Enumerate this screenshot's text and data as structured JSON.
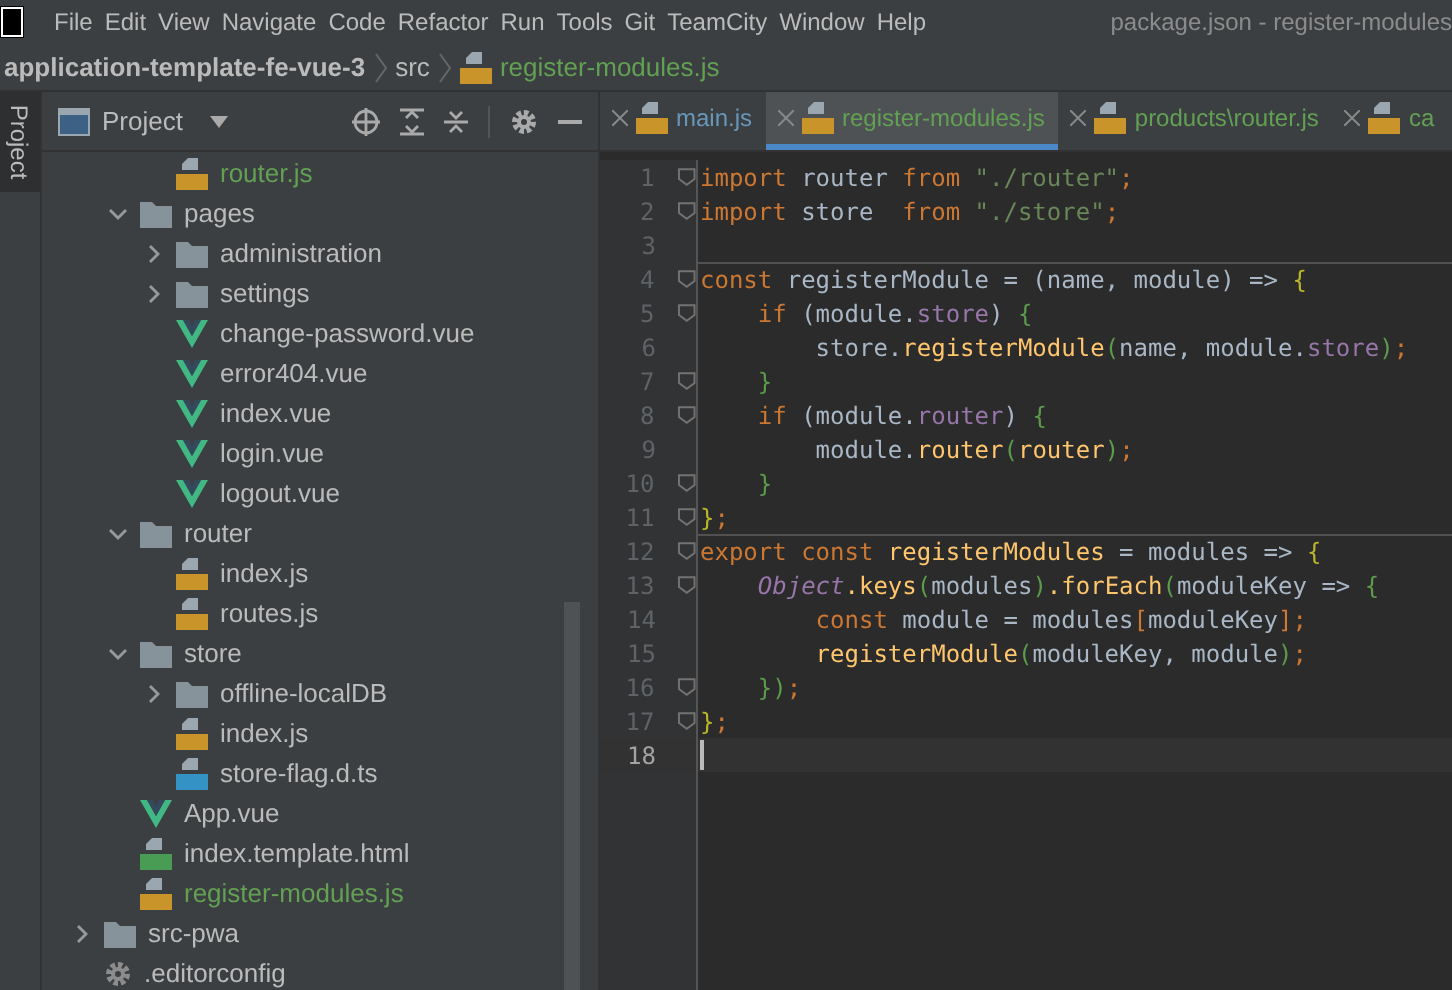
{
  "menu": {
    "items": [
      "File",
      "Edit",
      "View",
      "Navigate",
      "Code",
      "Refactor",
      "Run",
      "Tools",
      "Git",
      "TeamCity",
      "Window",
      "Help"
    ],
    "title": "package.json - register-modules"
  },
  "breadcrumb": [
    {
      "label": "application-template-fe-vue-3",
      "kind": "project"
    },
    {
      "label": "src",
      "kind": "folder"
    },
    {
      "label": "register-modules.js",
      "kind": "js"
    }
  ],
  "side_stripe": {
    "label": "Project"
  },
  "project_panel": {
    "title": "Project"
  },
  "tree": [
    {
      "children": [
        {
          "children": [
            {
              "name": "router.js",
              "kind": "js",
              "color": "#62a053"
            }
          ]
        },
        {
          "name": "pages",
          "kind": "folder",
          "expanded": true,
          "children": [
            {
              "name": "administration",
              "kind": "folder",
              "expanded": false
            },
            {
              "name": "settings",
              "kind": "folder",
              "expanded": false
            },
            {
              "name": "change-password.vue",
              "kind": "vue"
            },
            {
              "name": "error404.vue",
              "kind": "vue"
            },
            {
              "name": "index.vue",
              "kind": "vue"
            },
            {
              "name": "login.vue",
              "kind": "vue"
            },
            {
              "name": "logout.vue",
              "kind": "vue"
            }
          ]
        },
        {
          "name": "router",
          "kind": "folder",
          "expanded": true,
          "children": [
            {
              "name": "index.js",
              "kind": "js"
            },
            {
              "name": "routes.js",
              "kind": "js"
            }
          ]
        },
        {
          "name": "store",
          "kind": "folder",
          "expanded": true,
          "children": [
            {
              "name": "offline-localDB",
              "kind": "folder",
              "expanded": false
            },
            {
              "name": "index.js",
              "kind": "js"
            },
            {
              "name": "store-flag.d.ts",
              "kind": "ts"
            }
          ]
        },
        {
          "name": "App.vue",
          "kind": "vue"
        },
        {
          "name": "index.template.html",
          "kind": "html"
        },
        {
          "name": "register-modules.js",
          "kind": "js",
          "color": "#62a053"
        }
      ]
    },
    {
      "name": "src-pwa",
      "kind": "folder",
      "expanded": false
    },
    {
      "name": ".editorconfig",
      "kind": "config"
    }
  ],
  "tabs": [
    {
      "label": "main.js",
      "color": "#6897bb",
      "selected": false
    },
    {
      "label": "register-modules.js",
      "color": "#62a053",
      "selected": true
    },
    {
      "label": "products\\router.js",
      "color": "#62a053",
      "selected": false
    },
    {
      "label": "ca",
      "color": "#62a053",
      "selected": false
    }
  ],
  "editor": {
    "lines": [
      {
        "number": "1",
        "fold": true,
        "separator_above": false,
        "current": false,
        "tokens": [
          {
            "text": "import",
            "kind": "kw"
          },
          {
            "text": " router ",
            "kind": "id"
          },
          {
            "text": "from",
            "kind": "kw"
          },
          {
            "text": " \"./router\"",
            "kind": "str"
          },
          {
            "text": ";",
            "kind": "kw"
          }
        ]
      },
      {
        "number": "2",
        "fold": true,
        "separator_above": false,
        "current": false,
        "tokens": [
          {
            "text": "import",
            "kind": "kw"
          },
          {
            "text": " store  ",
            "kind": "id"
          },
          {
            "text": "from",
            "kind": "kw"
          },
          {
            "text": " \"./store\"",
            "kind": "str"
          },
          {
            "text": ";",
            "kind": "kw"
          }
        ]
      },
      {
        "number": "3",
        "fold": false,
        "separator_above": false,
        "current": false
      },
      {
        "number": "4",
        "fold": true,
        "separator_above": true,
        "current": false,
        "tokens": [
          {
            "text": "const",
            "kind": "kw"
          },
          {
            "text": " registerModule = (name, module) => ",
            "kind": "id"
          },
          {
            "text": "{",
            "kind": "br2"
          }
        ]
      },
      {
        "number": "5",
        "fold": true,
        "separator_above": false,
        "current": false,
        "tokens": [
          {
            "text": "    if",
            "kind": "kw"
          },
          {
            "text": " (module.",
            "kind": "id"
          },
          {
            "text": "store",
            "kind": "prop"
          },
          {
            "text": ") ",
            "kind": "id"
          },
          {
            "text": "{",
            "kind": "br"
          }
        ]
      },
      {
        "number": "6",
        "fold": false,
        "separator_above": false,
        "current": false,
        "tokens": [
          {
            "text": "        store.",
            "kind": "id"
          },
          {
            "text": "registerModule",
            "kind": "fn"
          },
          {
            "text": "(",
            "kind": "br"
          },
          {
            "text": "name, module.",
            "kind": "id"
          },
          {
            "text": "store",
            "kind": "prop"
          },
          {
            "text": ")",
            "kind": "br"
          },
          {
            "text": ";",
            "kind": "kw"
          }
        ]
      },
      {
        "number": "7",
        "fold": true,
        "separator_above": false,
        "current": false,
        "tokens": [
          {
            "text": "    }",
            "kind": "br"
          }
        ]
      },
      {
        "number": "8",
        "fold": true,
        "separator_above": false,
        "current": false,
        "tokens": [
          {
            "text": "    if",
            "kind": "kw"
          },
          {
            "text": " (module.",
            "kind": "id"
          },
          {
            "text": "router",
            "kind": "prop"
          },
          {
            "text": ") ",
            "kind": "id"
          },
          {
            "text": "{",
            "kind": "br"
          }
        ]
      },
      {
        "number": "9",
        "fold": false,
        "separator_above": false,
        "current": false,
        "tokens": [
          {
            "text": "        module.",
            "kind": "id"
          },
          {
            "text": "router",
            "kind": "fn"
          },
          {
            "text": "(",
            "kind": "br"
          },
          {
            "text": "router",
            "kind": "fn"
          },
          {
            "text": ")",
            "kind": "br"
          },
          {
            "text": ";",
            "kind": "kw"
          }
        ]
      },
      {
        "number": "10",
        "fold": true,
        "separator_above": false,
        "current": false,
        "tokens": [
          {
            "text": "    }",
            "kind": "br"
          }
        ]
      },
      {
        "number": "11",
        "fold": true,
        "separator_above": false,
        "current": false,
        "tokens": [
          {
            "text": "}",
            "kind": "br2"
          },
          {
            "text": ";",
            "kind": "kw"
          }
        ]
      },
      {
        "number": "12",
        "fold": true,
        "separator_above": true,
        "current": false,
        "tokens": [
          {
            "text": "export const",
            "kind": "kw"
          },
          {
            "text": " registerModules",
            "kind": "fn"
          },
          {
            "text": " = modules => ",
            "kind": "id"
          },
          {
            "text": "{",
            "kind": "br2"
          }
        ]
      },
      {
        "number": "13",
        "fold": true,
        "separator_above": false,
        "current": false,
        "tokens": [
          {
            "text": "    Object",
            "kind": "glob"
          },
          {
            "text": ".keys",
            "kind": "fn"
          },
          {
            "text": "(",
            "kind": "br"
          },
          {
            "text": "modules",
            "kind": "id"
          },
          {
            "text": ")",
            "kind": "br"
          },
          {
            "text": ".forEach",
            "kind": "fn"
          },
          {
            "text": "(",
            "kind": "br"
          },
          {
            "text": "moduleKey => ",
            "kind": "id"
          },
          {
            "text": "{",
            "kind": "br"
          }
        ]
      },
      {
        "number": "14",
        "fold": false,
        "separator_above": false,
        "current": false,
        "tokens": [
          {
            "text": "        const",
            "kind": "kw"
          },
          {
            "text": " module = modules",
            "kind": "id"
          },
          {
            "text": "[",
            "kind": "kw"
          },
          {
            "text": "moduleKey",
            "kind": "id"
          },
          {
            "text": "];",
            "kind": "kw"
          }
        ]
      },
      {
        "number": "15",
        "fold": false,
        "separator_above": false,
        "current": false,
        "tokens": [
          {
            "text": "        registerModule",
            "kind": "fn"
          },
          {
            "text": "(",
            "kind": "br"
          },
          {
            "text": "moduleKey, module",
            "kind": "id"
          },
          {
            "text": ")",
            "kind": "br"
          },
          {
            "text": ";",
            "kind": "kw"
          }
        ]
      },
      {
        "number": "16",
        "fold": true,
        "separator_above": false,
        "current": false,
        "tokens": [
          {
            "text": "    })",
            "kind": "br"
          },
          {
            "text": ";",
            "kind": "kw"
          }
        ]
      },
      {
        "number": "17",
        "fold": true,
        "separator_above": false,
        "current": false,
        "tokens": [
          {
            "text": "}",
            "kind": "br2"
          },
          {
            "text": ";",
            "kind": "kw"
          }
        ]
      },
      {
        "number": "18",
        "fold": false,
        "separator_above": false,
        "current": true
      }
    ]
  }
}
